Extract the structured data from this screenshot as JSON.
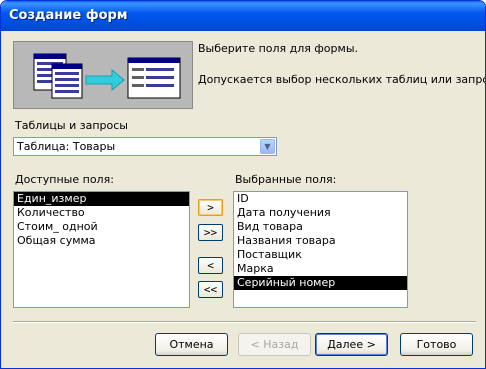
{
  "window": {
    "title": "Создание форм"
  },
  "intro": {
    "line1": "Выберите поля для формы.",
    "line2": "Допускается выбор нескольких таблиц или запросов."
  },
  "tables": {
    "label": "Таблицы и запросы",
    "selected": "Таблица: Товары"
  },
  "available": {
    "label": "Доступные поля:",
    "items": [
      "Един_измер",
      "Количество",
      "Стоим_ одной",
      "Общая сумма"
    ],
    "selected_index": 0
  },
  "chosen": {
    "label": "Выбранные поля:",
    "items": [
      "ID",
      "Дата получения",
      "Вид товара",
      "Названия товара",
      "Поставщик",
      "Марка",
      "Серийный номер"
    ],
    "selected_index": 6
  },
  "move_buttons": {
    "add_one": ">",
    "add_all": ">>",
    "remove_one": "<",
    "remove_all": "<<"
  },
  "footer": {
    "cancel": "Отмена",
    "back": "< Назад",
    "next": "Далее >",
    "finish": "Готово"
  },
  "colors": {
    "titlebar": "#0054e3",
    "dialog_bg": "#ece9d8",
    "selection": "#000000",
    "hero_bg": "#b8b8b8",
    "accent_arrow": "#33ccdd"
  }
}
